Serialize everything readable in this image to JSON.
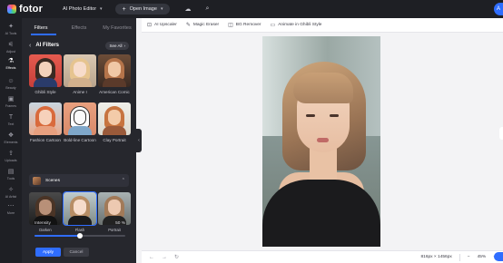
{
  "topbar": {
    "logo_text": "fotor",
    "editor_label": "AI Photo Editor",
    "open_image_label": "Open Image",
    "avatar_text": "A"
  },
  "rail": [
    {
      "icon": "sparkle-icon",
      "glyph": "✦",
      "label": "AI Tools"
    },
    {
      "icon": "sliders-icon",
      "glyph": "⚟",
      "label": "Adjust"
    },
    {
      "icon": "flask-icon",
      "glyph": "⚗",
      "label": "Effects"
    },
    {
      "icon": "smile-icon",
      "glyph": "☺",
      "label": "Beauty"
    },
    {
      "icon": "frame-icon",
      "glyph": "▣",
      "label": "Frames"
    },
    {
      "icon": "text-icon",
      "glyph": "T",
      "label": "Text"
    },
    {
      "icon": "elements-icon",
      "glyph": "❖",
      "label": "Elements"
    },
    {
      "icon": "upload-icon",
      "glyph": "⇪",
      "label": "Uploads"
    },
    {
      "icon": "tools-icon",
      "glyph": "▤",
      "label": "Tools"
    },
    {
      "icon": "ai-icon",
      "glyph": "✧",
      "label": "AI Artist"
    },
    {
      "icon": "more-icon",
      "glyph": "⋯",
      "label": "More"
    }
  ],
  "panel": {
    "tabs": [
      "Filters",
      "Effects",
      "My Favorites"
    ],
    "section_title": "AI Filters",
    "see_all_label": "See All",
    "filters": [
      {
        "label": "Ghibli Style"
      },
      {
        "label": "Anime I"
      },
      {
        "label": "American Comic"
      },
      {
        "label": "Fashion Cartoon"
      },
      {
        "label": "Bold-line Cartoon"
      },
      {
        "label": "Clay Portrait"
      }
    ],
    "scenes_label": "Scenes",
    "scenes": [
      {
        "label": "Darken"
      },
      {
        "label": "Flash"
      },
      {
        "label": "Portrait"
      }
    ],
    "intensity_label": "Intensity",
    "intensity_value": "50 %",
    "intensity_percent": 50,
    "apply_label": "Apply",
    "cancel_label": "Cancel"
  },
  "canvas_toolbar": [
    {
      "icon": "ai-upscaler-icon",
      "label": "AI Upscaler"
    },
    {
      "icon": "magic-eraser-icon",
      "label": "Magic Eraser"
    },
    {
      "icon": "bg-remover-icon",
      "label": "BG Remover"
    },
    {
      "icon": "animate-icon",
      "label": "Animate in Ghibli Style"
    }
  ],
  "bottombar": {
    "dimensions": "816px × 1456px",
    "zoom": "45%"
  },
  "colors": {
    "accent": "#2f6dff",
    "panel_bg": "#26272d",
    "rail_bg": "#1e1f24"
  }
}
